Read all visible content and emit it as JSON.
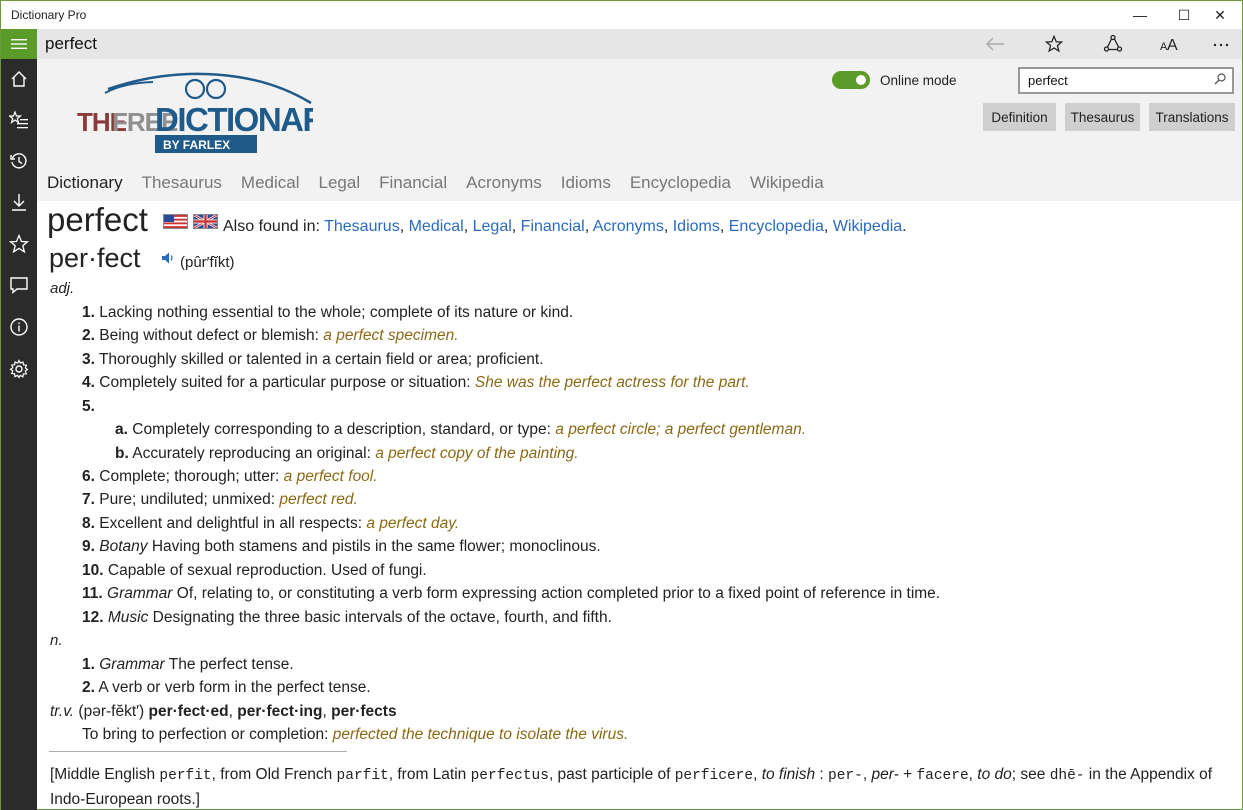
{
  "window": {
    "title": "Dictionary Pro",
    "controls": {
      "minimize": "—",
      "maximize": "☐",
      "close": "✕"
    }
  },
  "header": {
    "word": "perfect"
  },
  "online_mode": {
    "label": "Online mode",
    "on": true
  },
  "search": {
    "value": "perfect"
  },
  "view_buttons": [
    "Definition",
    "Thesaurus",
    "Translations"
  ],
  "logo": {
    "line1a": "THE",
    "line1b": "FREE",
    "line1c": "DICTIONARY",
    "line2": "BY FARLEX"
  },
  "tabs": [
    "Dictionary",
    "Thesaurus",
    "Medical",
    "Legal",
    "Financial",
    "Acronyms",
    "Idioms",
    "Encyclopedia",
    "Wikipedia"
  ],
  "entry": {
    "headword": "perfect",
    "also_found_label": "Also found in:",
    "also_found": [
      "Thesaurus",
      "Medical",
      "Legal",
      "Financial",
      "Acronyms",
      "Idioms",
      "Encyclopedia",
      "Wikipedia"
    ],
    "syllabified": "per·fect",
    "ipa": "(pûr′fĭkt)",
    "adj_label": "adj.",
    "adj_senses": [
      {
        "num": "1.",
        "text": "Lacking nothing essential to the whole; complete of its nature or kind.",
        "example": ""
      },
      {
        "num": "2.",
        "text": "Being without defect or blemish: ",
        "example": "a perfect specimen."
      },
      {
        "num": "3.",
        "text": "Thoroughly skilled or talented in a certain field or area; proficient.",
        "example": ""
      },
      {
        "num": "4.",
        "text": "Completely suited for a particular purpose or situation: ",
        "example": "She was the perfect actress for the part."
      },
      {
        "num": "5.",
        "text": "",
        "example": ""
      }
    ],
    "sub_senses": [
      {
        "num": "a.",
        "text": "Completely corresponding to a description, standard, or type: ",
        "example": "a perfect circle; a perfect gentleman."
      },
      {
        "num": "b.",
        "text": "Accurately reproducing an original: ",
        "example": "a perfect copy of the painting."
      }
    ],
    "adj_senses_2": [
      {
        "num": "6.",
        "label": "",
        "text": "Complete; thorough; utter: ",
        "example": "a perfect fool."
      },
      {
        "num": "7.",
        "label": "",
        "text": "Pure; undiluted; unmixed: ",
        "example": "perfect red."
      },
      {
        "num": "8.",
        "label": "",
        "text": "Excellent and delightful in all respects: ",
        "example": "a perfect day."
      },
      {
        "num": "9.",
        "label": "Botany",
        "text": " Having both stamens and pistils in the same flower; monoclinous.",
        "example": ""
      },
      {
        "num": "10.",
        "label": "",
        "text": "Capable of sexual reproduction. Used of fungi.",
        "example": ""
      },
      {
        "num": "11.",
        "label": "Grammar",
        "text": " Of, relating to, or constituting a verb form expressing action completed prior to a fixed point of reference in time.",
        "example": ""
      },
      {
        "num": "12.",
        "label": "Music",
        "text": " Designating the three basic intervals of the octave, fourth, and fifth.",
        "example": ""
      }
    ],
    "noun_label": "n.",
    "noun_senses": [
      {
        "num": "1.",
        "label": "Grammar",
        "text": " The perfect tense."
      },
      {
        "num": "2.",
        "label": "",
        "text": "A verb or verb form in the perfect tense."
      }
    ],
    "verb_label": "tr.v.",
    "verb_pron": " (pər-fĕkt′) ",
    "verb_forms": [
      "per·fect·ed",
      "per·fect·ing",
      "per·fects"
    ],
    "verb_sense": {
      "text": "To bring to perfection or completion: ",
      "example": "perfected the technique to isolate the virus."
    },
    "etymology": {
      "t1": "[Middle English ",
      "m1": "perfit",
      "t2": ", from Old French ",
      "m2": "parfit",
      "t3": ", from Latin ",
      "m3": "perfectus",
      "t4": ", past participle of ",
      "m4": "perficere",
      "t5": ", ",
      "i1": "to finish",
      "t6": " : ",
      "m5": "per-",
      "t7": ", ",
      "i2": "per-",
      "t8": " + ",
      "m6": "facere",
      "t9": ", ",
      "i3": "to do",
      "t10": "; see ",
      "m7": "dhē-",
      "t11": " in the Appendix of Indo-European roots.]"
    }
  }
}
